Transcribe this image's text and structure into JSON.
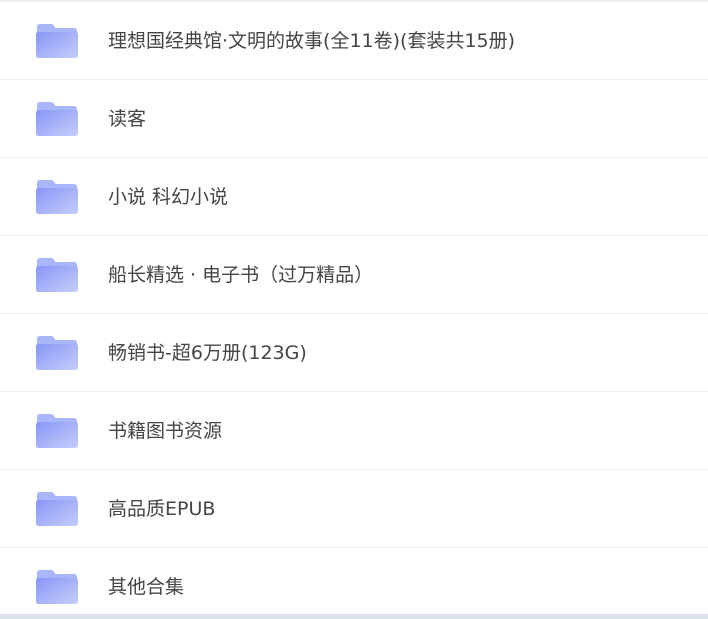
{
  "folders": [
    {
      "name": "理想国经典馆·文明的故事(全11卷)(套装共15册)",
      "icon": "folder-icon"
    },
    {
      "name": "读客",
      "icon": "folder-icon"
    },
    {
      "name": "小说 科幻小说",
      "icon": "folder-icon"
    },
    {
      "name": "船长精选 · 电子书（过万精品）",
      "icon": "folder-icon"
    },
    {
      "name": "畅销书-超6万册(123G)",
      "icon": "folder-icon"
    },
    {
      "name": "书籍图书资源",
      "icon": "folder-icon"
    },
    {
      "name": "高品质EPUB",
      "icon": "folder-icon"
    },
    {
      "name": "其他合集",
      "icon": "folder-icon"
    }
  ],
  "colors": {
    "folder_light": "#c4cdfb",
    "folder_dark": "#7f92f5",
    "text": "#454545",
    "divider": "#eeeeee"
  }
}
